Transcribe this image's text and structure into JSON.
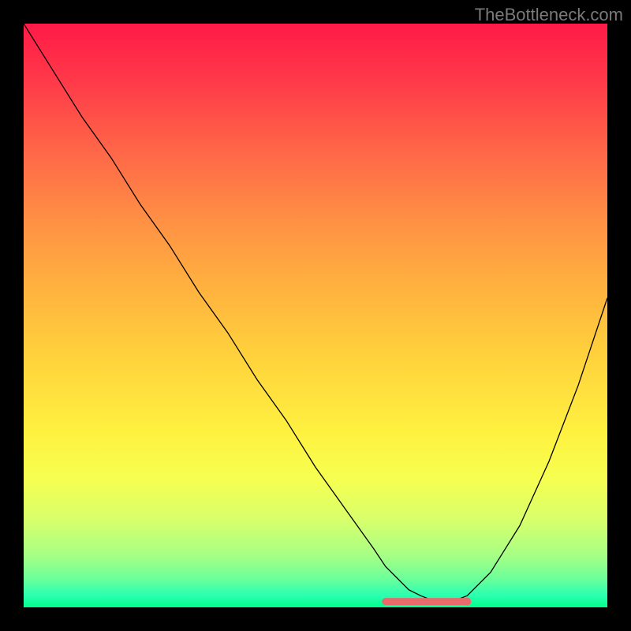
{
  "watermark": "TheBottleneck.com",
  "chart_data": {
    "type": "line",
    "title": "",
    "xlabel": "",
    "ylabel": "",
    "xlim": [
      0,
      100
    ],
    "ylim": [
      0,
      100
    ],
    "curve": {
      "x": [
        0,
        5,
        10,
        15,
        20,
        25,
        30,
        35,
        40,
        45,
        50,
        55,
        60,
        62,
        64,
        66,
        68,
        70,
        72,
        74,
        76,
        80,
        85,
        90,
        95,
        100
      ],
      "y": [
        100,
        92,
        84,
        77,
        69,
        62,
        54,
        47,
        39,
        32,
        24,
        17,
        10,
        7,
        5,
        3,
        2,
        1.2,
        1,
        1.2,
        2,
        6,
        14,
        25,
        38,
        53
      ]
    },
    "marker_zone": {
      "x_start": 62,
      "x_end": 76,
      "y": 1
    },
    "marker_dot": {
      "x": 76,
      "y": 1
    }
  }
}
